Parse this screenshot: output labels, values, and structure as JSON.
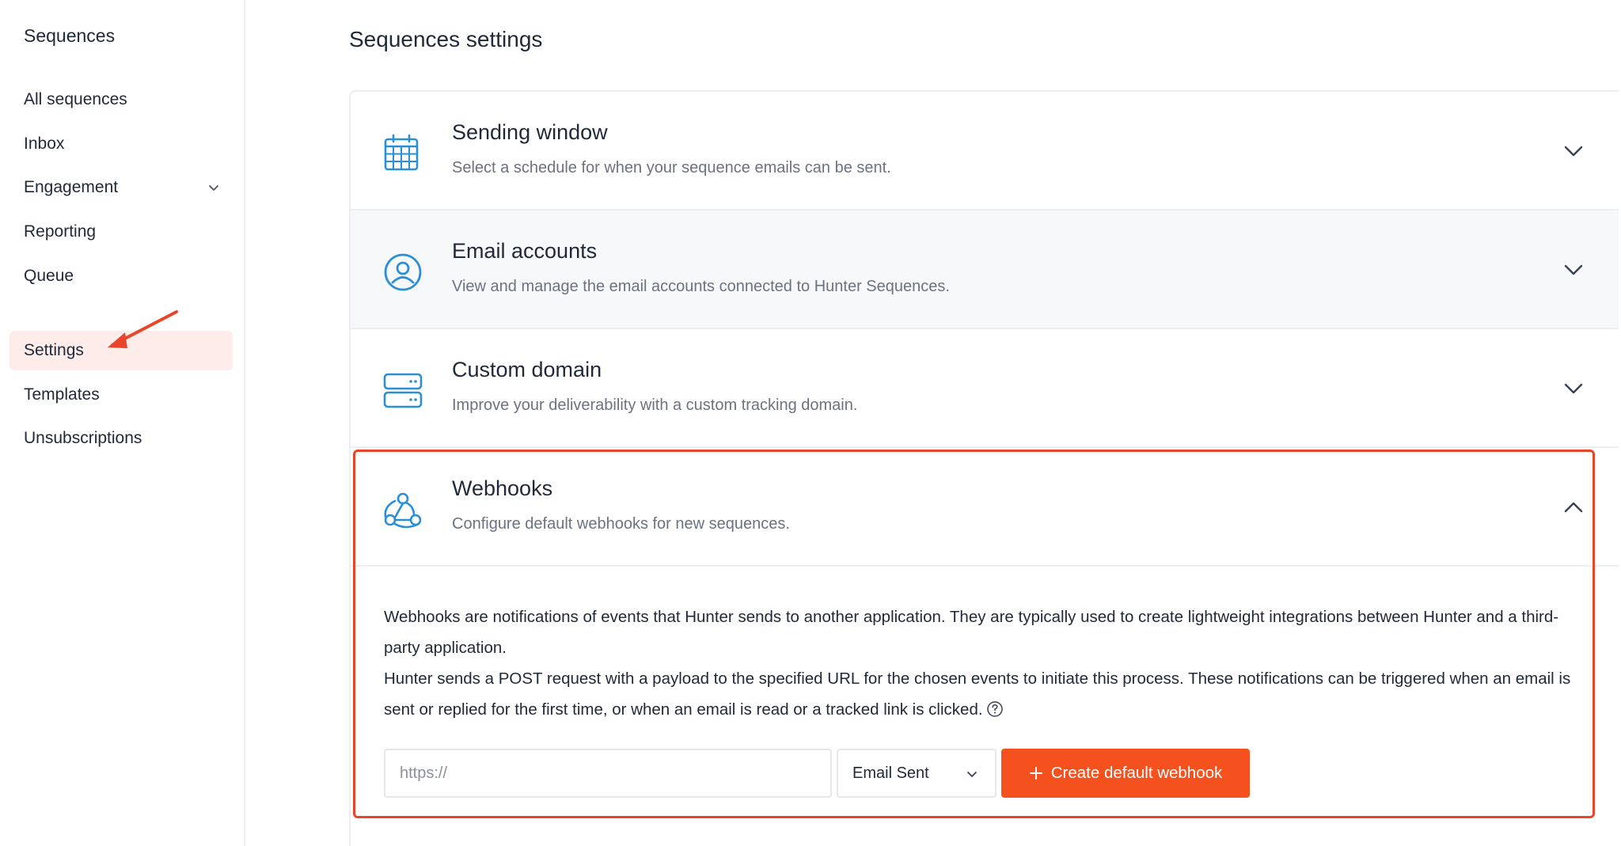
{
  "sidebar": {
    "title": "Sequences",
    "items": [
      {
        "label": "All sequences"
      },
      {
        "label": "Inbox"
      },
      {
        "label": "Engagement"
      },
      {
        "label": "Reporting"
      },
      {
        "label": "Queue"
      },
      {
        "label": "Settings"
      },
      {
        "label": "Templates"
      },
      {
        "label": "Unsubscriptions"
      }
    ],
    "active_item": "Settings"
  },
  "main": {
    "page_title": "Sequences settings",
    "sections": [
      {
        "title": "Sending window",
        "description": "Select a schedule for when your sequence emails can be sent.",
        "icon": "calendar-icon",
        "expanded": false
      },
      {
        "title": "Email accounts",
        "description": "View and manage the email accounts connected to Hunter Sequences.",
        "icon": "user-circle-icon",
        "expanded": false
      },
      {
        "title": "Custom domain",
        "description": "Improve your deliverability with a custom tracking domain.",
        "icon": "server-icon",
        "expanded": false
      },
      {
        "title": "Webhooks",
        "description": "Configure default webhooks for new sequences.",
        "icon": "webhook-icon",
        "expanded": true
      }
    ],
    "webhooks": {
      "paragraph_1": "Webhooks are notifications of events that Hunter sends to another application. They are typically used to create lightweight integrations between Hunter and a third-party application.",
      "paragraph_2": "Hunter sends a POST request with a payload to the specified URL for the chosen events to initiate this process. These notifications can be triggered when an email is sent or replied for the first time, or when an email is read or a tracked link is clicked.",
      "url_placeholder": "https://",
      "url_value": "",
      "event_selected": "Email Sent",
      "create_button_label": "Create default webhook"
    }
  },
  "colors": {
    "accent": "#f4511e",
    "icon_blue": "#2b8fd6",
    "annotation_red": "#e8452a",
    "active_bg": "#fdecea"
  }
}
